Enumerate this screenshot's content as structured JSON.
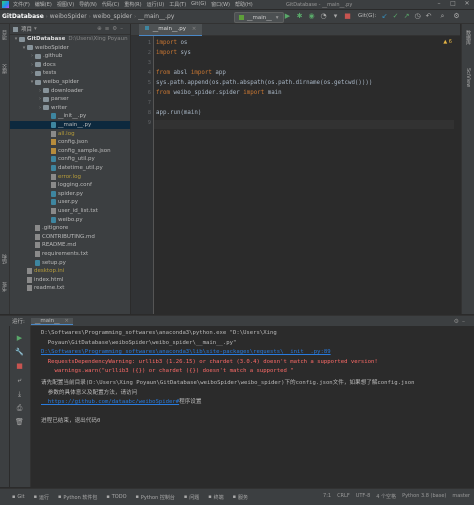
{
  "menu": {
    "items": [
      "文件(F)",
      "编辑(E)",
      "视图(V)",
      "导航(N)",
      "代码(C)",
      "重构(R)",
      "运行(U)",
      "工具(T)",
      "Git(G)",
      "窗口(W)",
      "帮助(H)"
    ],
    "window_title": "GitDatabase - __main__.py"
  },
  "nav": {
    "crumbs": [
      "GitDatabase",
      "weiboSpider",
      "weibo_spider",
      "__main__.py"
    ],
    "run_config": "__main__",
    "git_label": "Git(G):"
  },
  "project": {
    "title": "项目",
    "tree": [
      {
        "label": "GitDatabase",
        "extra": "D:\\Users\\Xing Poyaun",
        "depth": 0,
        "type": "folder",
        "open": true
      },
      {
        "label": "weiboSpider",
        "depth": 1,
        "type": "folder",
        "open": true
      },
      {
        "label": ".github",
        "depth": 2,
        "type": "folder",
        "open": false
      },
      {
        "label": "docs",
        "depth": 2,
        "type": "folder",
        "open": false
      },
      {
        "label": "tests",
        "depth": 2,
        "type": "folder",
        "open": false
      },
      {
        "label": "weibo_spider",
        "depth": 2,
        "type": "folder",
        "open": true
      },
      {
        "label": "downloader",
        "depth": 3,
        "type": "folder",
        "open": false
      },
      {
        "label": "parser",
        "depth": 3,
        "type": "folder",
        "open": false
      },
      {
        "label": "writer",
        "depth": 3,
        "type": "folder",
        "open": false
      },
      {
        "label": "__init__.py",
        "depth": 4,
        "type": "py"
      },
      {
        "label": "__main__.py",
        "depth": 4,
        "type": "py",
        "selected": true
      },
      {
        "label": "all.log",
        "depth": 4,
        "type": "log"
      },
      {
        "label": "config.json",
        "depth": 4,
        "type": "cfg"
      },
      {
        "label": "config_sample.json",
        "depth": 4,
        "type": "cfg"
      },
      {
        "label": "config_util.py",
        "depth": 4,
        "type": "py"
      },
      {
        "label": "datetime_util.py",
        "depth": 4,
        "type": "py"
      },
      {
        "label": "error.log",
        "depth": 4,
        "type": "log"
      },
      {
        "label": "logging.conf",
        "depth": 4,
        "type": "txt"
      },
      {
        "label": "spider.py",
        "depth": 4,
        "type": "py"
      },
      {
        "label": "user.py",
        "depth": 4,
        "type": "py"
      },
      {
        "label": "user_id_list.txt",
        "depth": 4,
        "type": "txt"
      },
      {
        "label": "weibo.py",
        "depth": 4,
        "type": "py"
      },
      {
        "label": ".gitignore",
        "depth": 2,
        "type": "txt"
      },
      {
        "label": "CONTRIBUTING.md",
        "depth": 2,
        "type": "txt"
      },
      {
        "label": "README.md",
        "depth": 2,
        "type": "txt"
      },
      {
        "label": "requirements.txt",
        "depth": 2,
        "type": "txt"
      },
      {
        "label": "setup.py",
        "depth": 2,
        "type": "py"
      },
      {
        "label": "desktop.ini",
        "depth": 1,
        "type": "log"
      },
      {
        "label": "index.html",
        "depth": 1,
        "type": "txt"
      },
      {
        "label": "readme.txt",
        "depth": 1,
        "type": "txt"
      }
    ]
  },
  "editor": {
    "tab": "__main__.py",
    "warnings": "▲ 6",
    "lines": [
      {
        "n": "1",
        "tokens": [
          [
            "kw",
            "import "
          ],
          [
            "",
            "os"
          ]
        ]
      },
      {
        "n": "2",
        "tokens": [
          [
            "kw",
            "import "
          ],
          [
            "",
            "sys"
          ]
        ]
      },
      {
        "n": "3",
        "tokens": []
      },
      {
        "n": "4",
        "tokens": [
          [
            "kw",
            "from "
          ],
          [
            "",
            "absl "
          ],
          [
            "kw",
            "import "
          ],
          [
            "",
            "app"
          ]
        ]
      },
      {
        "n": "5",
        "tokens": [
          [
            "",
            "sys.path.append(os.path.abspath(os.path.dirname(os.getcwd())))"
          ]
        ]
      },
      {
        "n": "6",
        "tokens": [
          [
            "kw",
            "from "
          ],
          [
            "",
            "weibo_spider.spider "
          ],
          [
            "kw",
            "import "
          ],
          [
            "",
            "main"
          ]
        ]
      },
      {
        "n": "7",
        "tokens": []
      },
      {
        "n": "8",
        "tokens": [
          [
            "",
            "app.run(main)"
          ]
        ]
      },
      {
        "n": "9",
        "tokens": []
      }
    ]
  },
  "run": {
    "label": "运行:",
    "tab": "__main__",
    "console": [
      {
        "cls": "",
        "text": "D:\\Softwares\\Programming_softwares\\anaconda3\\python.exe \"D:\\Users\\Xing"
      },
      {
        "cls": "",
        "text": "  Poyaun\\GitDatabase\\weiboSpider\\weibo_spider\\__main__.py\""
      },
      {
        "cls": "link",
        "text": "D:\\Softwares\\Programming_softwares\\anaconda3\\lib\\site-packages\\requests\\__init__.py:89"
      },
      {
        "cls": "err",
        "text": "  RequestsDependencyWarning: urllib3 (1.26.15) or chardet (3.0.4) doesn't match a supported version!"
      },
      {
        "cls": "err",
        "text": "    warnings.warn(\"urllib3 ({}) or chardet ({}) doesn't match a supported \""
      },
      {
        "cls": "",
        "text": "请先配置当前目录(D:\\Users\\Xing Poyaun\\GitDatabase\\weiboSpider\\weibo_spider)下的config.json文件，如果想了解config.json"
      },
      {
        "cls": "",
        "text": "  参数的具体意义及配置方法，请访问"
      },
      {
        "cls": "mixed",
        "link": "https://github.com/dataabc/weiboSpider#",
        "rest": "程序设置"
      },
      {
        "cls": "",
        "text": ""
      },
      {
        "cls": "",
        "text": "进程已结束，退出代码0"
      }
    ]
  },
  "bottom": {
    "items": [
      "Git",
      "运行",
      "Python 软件包",
      "TODO",
      "Python 控制台",
      "问题",
      "终端",
      "服务"
    ],
    "status": [
      "7:1",
      "CRLF",
      "UTF-8",
      "4 个空格",
      "Python 3.8 (base)",
      "master"
    ]
  }
}
